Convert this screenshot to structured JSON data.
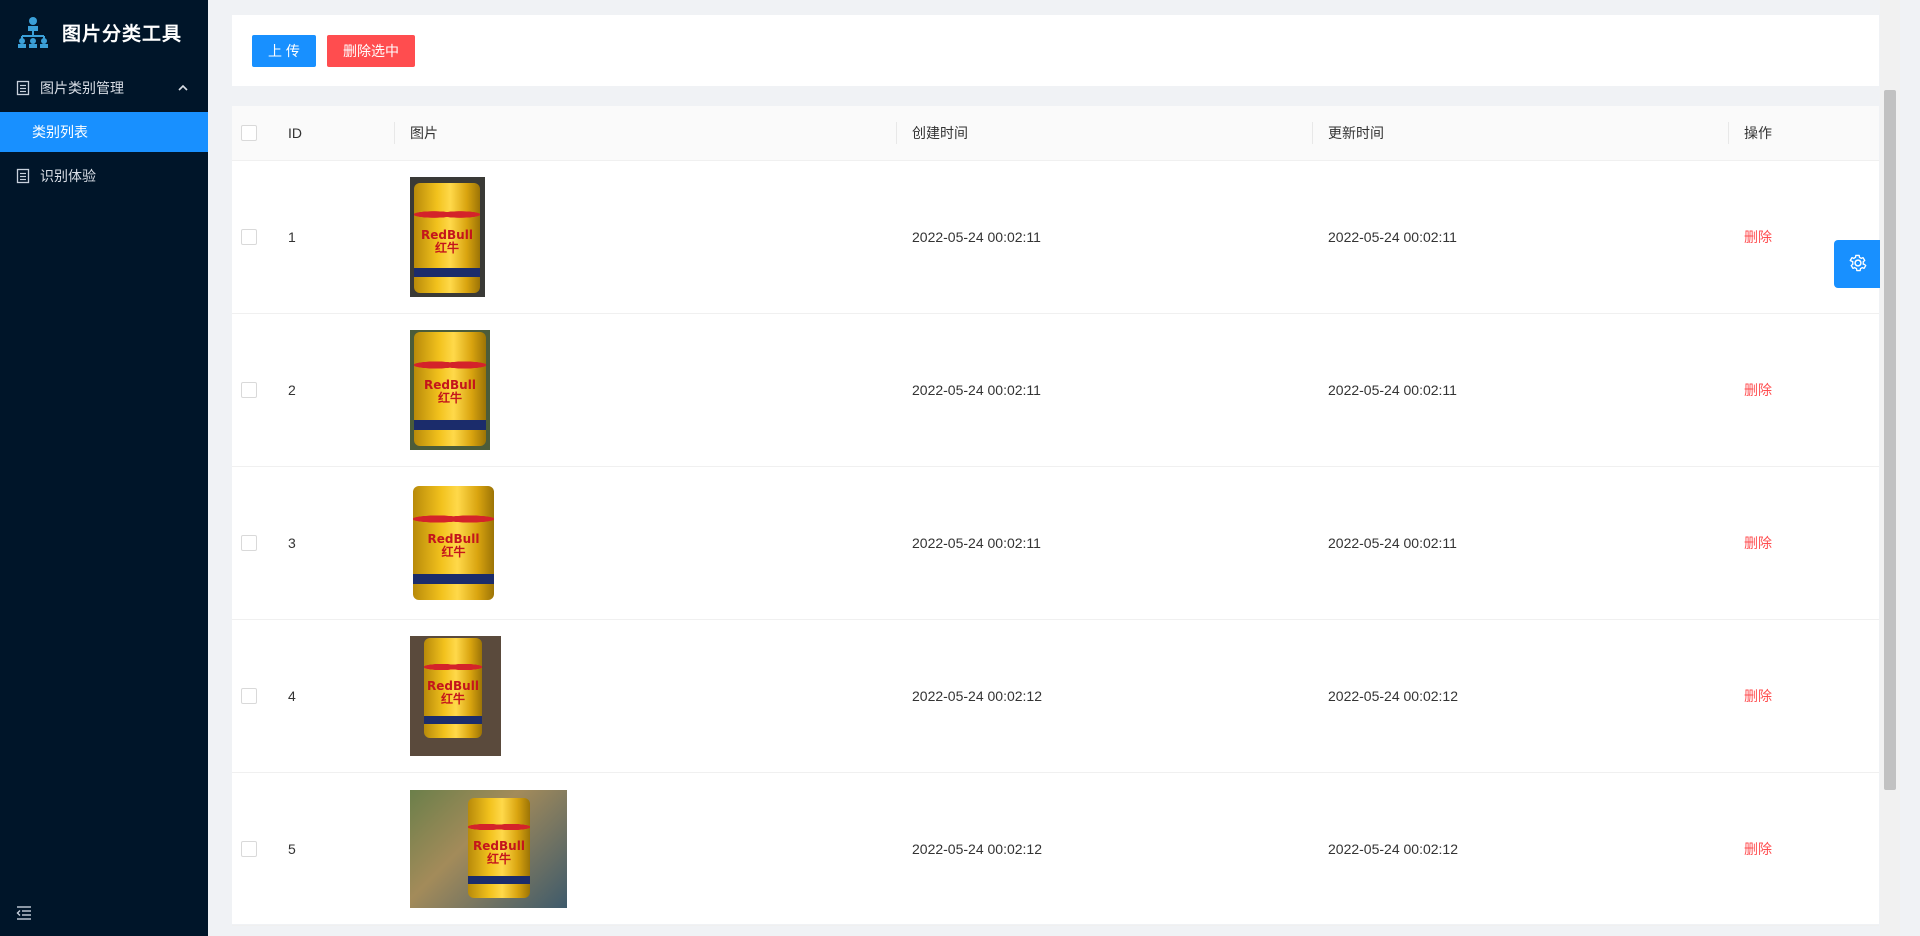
{
  "app": {
    "title": "图片分类工具",
    "logo_icon": "sitemap-icon"
  },
  "sidebar": {
    "items": [
      {
        "label": "图片类别管理",
        "icon": "file-icon",
        "expanded": true,
        "children": [
          {
            "label": "类别列表",
            "active": true
          }
        ]
      },
      {
        "label": "识别体验",
        "icon": "file-icon"
      }
    ],
    "collapse_icon": "menu-fold-icon"
  },
  "toolbar": {
    "upload_label": "上 传",
    "delete_selected_label": "删除选中"
  },
  "table": {
    "columns": [
      "ID",
      "图片",
      "创建时间",
      "更新时间",
      "操作"
    ],
    "rows": [
      {
        "id": "1",
        "created": "2022-05-24 00:02:11",
        "updated": "2022-05-24 00:02:11",
        "action": "删除"
      },
      {
        "id": "2",
        "created": "2022-05-24 00:02:11",
        "updated": "2022-05-24 00:02:11",
        "action": "删除"
      },
      {
        "id": "3",
        "created": "2022-05-24 00:02:11",
        "updated": "2022-05-24 00:02:11",
        "action": "删除"
      },
      {
        "id": "4",
        "created": "2022-05-24 00:02:12",
        "updated": "2022-05-24 00:02:12",
        "action": "删除"
      },
      {
        "id": "5",
        "created": "2022-05-24 00:02:12",
        "updated": "2022-05-24 00:02:12",
        "action": "删除"
      }
    ]
  },
  "thumb_text": {
    "brand": "RedBull",
    "cn": "红牛"
  },
  "colors": {
    "primary": "#1890ff",
    "danger": "#ff4d4f",
    "sidebar": "#001529"
  },
  "settings_icon": "gear-icon"
}
